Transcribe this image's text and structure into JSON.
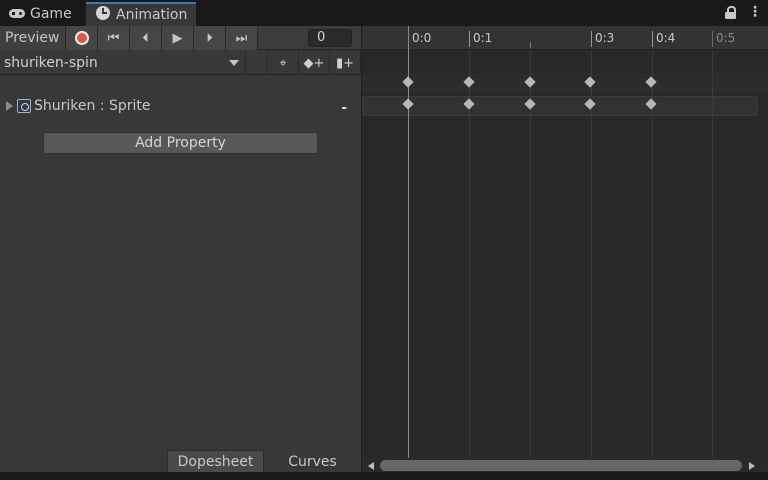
{
  "tabs": [
    {
      "label": "Game",
      "icon": "gamepad-icon"
    },
    {
      "label": "Animation",
      "icon": "clock-icon",
      "active": true
    }
  ],
  "toolbar": {
    "preview_label": "Preview",
    "frame_value": "0",
    "record_color": "#e2583e"
  },
  "clip": {
    "name": "shuriken-spin"
  },
  "properties": [
    {
      "label": "Shuriken : Sprite",
      "icon": "sprite-icon",
      "remove_label": "-"
    }
  ],
  "add_property_label": "Add Property",
  "bottom_tabs": {
    "dopesheet_label": "Dopesheet",
    "curves_label": "Curves"
  },
  "timeline": {
    "ticks": [
      "0:0",
      "0:1",
      "",
      "0:3",
      "0:4",
      "0:5"
    ],
    "keyframe_times": [
      0,
      1,
      2,
      3,
      4
    ],
    "playhead_frame": 0
  },
  "colors": {
    "accent": "#3a79bb"
  }
}
